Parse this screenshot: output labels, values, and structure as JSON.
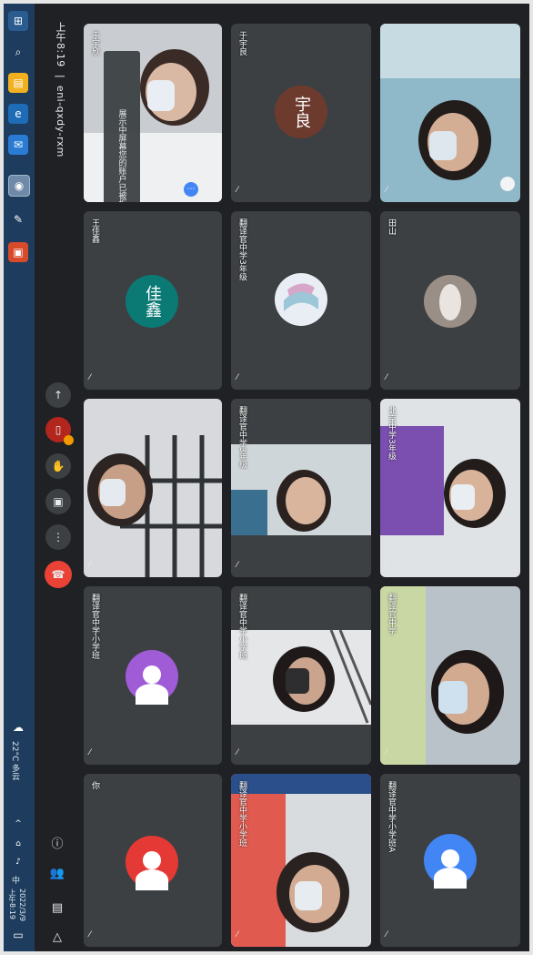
{
  "taskbar": {
    "clock_time": "上午8:19",
    "clock_date": "2022/3/9",
    "weather": "22°C 多云",
    "input_method": "中"
  },
  "meeting": {
    "time": "上午8:19",
    "separator": "|",
    "code": "eni-qxdy-rxm"
  },
  "tooltip": "展示中屏幕您的账户已被拒绝",
  "tiles": [
    {
      "name": "于宇欣",
      "type": "video",
      "pinned": true
    },
    {
      "name": "于宇良",
      "type": "avatar",
      "initial": "宇良",
      "color": "#6d3b2d"
    },
    {
      "name": "",
      "type": "video"
    },
    {
      "name": "王佳鑫",
      "type": "avatar",
      "initial": "佳鑫",
      "color": "#0b7a75"
    },
    {
      "name": "翻译官中学3年级",
      "type": "image-avatar"
    },
    {
      "name": "田山",
      "type": "image-avatar"
    },
    {
      "name": "",
      "type": "video"
    },
    {
      "name": "翻译官中学3年级",
      "type": "video"
    },
    {
      "name": "北京中学3年级",
      "type": "video"
    },
    {
      "name": "翻译官中学小学班",
      "type": "avatar-generic",
      "color": "#a05bd6"
    },
    {
      "name": "翻译官中学小学班",
      "type": "video"
    },
    {
      "name": "翻译官中学",
      "type": "video"
    },
    {
      "name": "你",
      "type": "avatar-generic",
      "color": "#e53935"
    },
    {
      "name": "翻译官中学小学班",
      "type": "video"
    },
    {
      "name": "翻译官中学小学班A",
      "type": "avatar-generic",
      "color": "#4285f4"
    }
  ],
  "icons": {
    "mic_off": "mic-off-icon",
    "raise_hand": "hand-icon",
    "present": "present-icon",
    "more": "more-icon",
    "end_call": "phone-hang-up-icon",
    "info": "info-icon",
    "people": "people-icon",
    "chat": "chat-icon",
    "activities": "activities-icon",
    "captions": "captions-icon",
    "camera": "camera-icon"
  },
  "colors": {
    "background": "#202124",
    "tile": "#3c4043",
    "end_call": "#ea4335",
    "taskbar": "#1d3c5e"
  }
}
